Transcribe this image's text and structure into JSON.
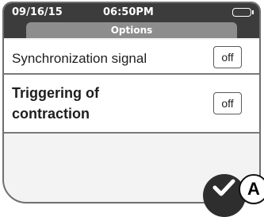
{
  "status_bar": {
    "date": "09/16/15",
    "time": "06:50PM",
    "battery_icon": "battery-icon"
  },
  "header": {
    "title": "Options"
  },
  "options": [
    {
      "label": "Synchronization signal",
      "state": "off"
    },
    {
      "label": "Triggering of contraction",
      "label_lines": [
        "Triggering of",
        "contraction"
      ],
      "state": "off"
    }
  ],
  "confirm": {
    "icon": "checkmark-icon"
  },
  "callout": {
    "label": "A"
  }
}
